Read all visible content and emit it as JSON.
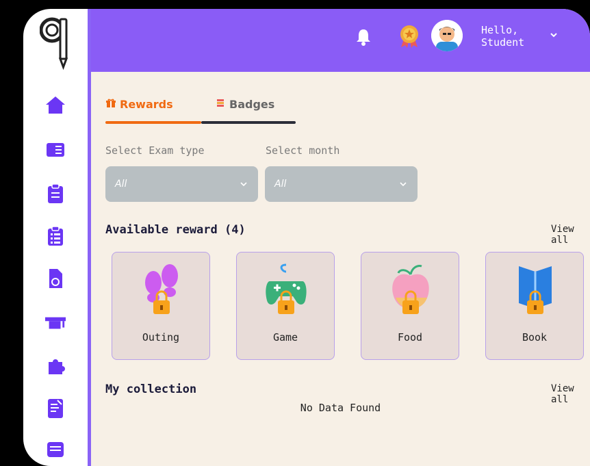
{
  "header": {
    "greeting_line1": "Hello,",
    "greeting_line2": "Student",
    "icons": [
      "bell-icon",
      "medal-icon",
      "avatar",
      "chevron-down-icon"
    ],
    "colors": {
      "header_bg": "#8a5cf6",
      "accent": "#f06a12"
    }
  },
  "sidebar": {
    "icons": [
      "home-icon",
      "book-icon",
      "clipboard-icon",
      "list-icon",
      "document-icon",
      "graduation-cap-icon",
      "puzzle-icon",
      "notes-icon",
      "message-icon"
    ]
  },
  "tabs": [
    {
      "label": "Rewards",
      "active": true
    },
    {
      "label": "Badges",
      "active": false
    }
  ],
  "filters": {
    "exam_type": {
      "label": "Select Exam type",
      "value": "All"
    },
    "month": {
      "label": "Select month",
      "value": "All"
    }
  },
  "available_reward": {
    "title": "Available reward (4)",
    "view_all": "View all",
    "items": [
      {
        "label": "Outing",
        "icon": "footprints-icon"
      },
      {
        "label": "Game",
        "icon": "gamepad-icon"
      },
      {
        "label": "Food",
        "icon": "apple-icon"
      },
      {
        "label": "Book",
        "icon": "book-open-icon"
      }
    ]
  },
  "my_collection": {
    "title": "My collection",
    "view_all": "View all",
    "empty_text": "No Data Found"
  }
}
